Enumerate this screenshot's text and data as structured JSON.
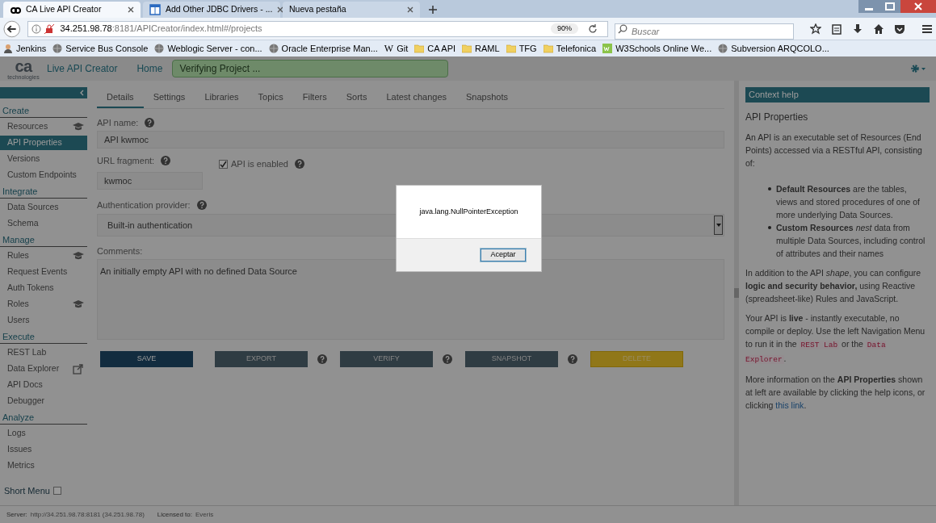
{
  "browser": {
    "tabs": [
      {
        "title": "CA Live API Creator",
        "selected": true
      },
      {
        "title": "Add Other JDBC Drivers - ...",
        "selected": false
      },
      {
        "title": "Nueva pestaña",
        "selected": false
      }
    ],
    "address": {
      "host": "34.251.98.78",
      "path": ":8181/APICreator/index.html#/projects"
    },
    "zoom": "90%",
    "search": {
      "placeholder": "Buscar"
    },
    "bookmarks": [
      {
        "label": "Jenkins"
      },
      {
        "label": "Service Bus Console"
      },
      {
        "label": "Weblogic Server - con..."
      },
      {
        "label": "Oracle Enterprise Man..."
      },
      {
        "label": "Git",
        "badge": "W"
      },
      {
        "label": "CA API"
      },
      {
        "label": "RAML"
      },
      {
        "label": "TFG"
      },
      {
        "label": "Telefonica"
      },
      {
        "label": "W3Schools Online We..."
      },
      {
        "label": "Subversion ARQCOLO..."
      }
    ]
  },
  "app": {
    "logo": {
      "mark": "ca",
      "sub": "technologies"
    },
    "product": "Live API Creator",
    "home": "Home",
    "status": "Verifying Project ..."
  },
  "sidebar": {
    "sections": [
      {
        "title": "Create",
        "items": [
          {
            "label": "Resources",
            "selected": false
          },
          {
            "label": "API Properties",
            "selected": true
          },
          {
            "label": "Versions",
            "selected": false
          },
          {
            "label": "Custom Endpoints",
            "selected": false
          }
        ]
      },
      {
        "title": "Integrate",
        "items": [
          {
            "label": "Data Sources",
            "selected": false
          },
          {
            "label": "Schema",
            "selected": false
          }
        ]
      },
      {
        "title": "Manage",
        "items": [
          {
            "label": "Rules",
            "selected": false
          },
          {
            "label": "Request Events",
            "selected": false
          },
          {
            "label": "Auth Tokens",
            "selected": false
          },
          {
            "label": "Roles",
            "selected": false
          },
          {
            "label": "Users",
            "selected": false
          }
        ]
      },
      {
        "title": "Execute",
        "items": [
          {
            "label": "REST Lab",
            "selected": false
          },
          {
            "label": "Data Explorer",
            "selected": false
          },
          {
            "label": "API Docs",
            "selected": false
          },
          {
            "label": "Debugger",
            "selected": false
          }
        ]
      },
      {
        "title": "Analyze",
        "items": [
          {
            "label": "Logs",
            "selected": false
          },
          {
            "label": "Issues",
            "selected": false
          },
          {
            "label": "Metrics",
            "selected": false
          }
        ]
      }
    ],
    "short_menu": {
      "label": "Short Menu",
      "checked": false
    }
  },
  "tabs": [
    {
      "label": "Details",
      "selected": true
    },
    {
      "label": "Settings",
      "selected": false
    },
    {
      "label": "Libraries",
      "selected": false
    },
    {
      "label": "Topics",
      "selected": false
    },
    {
      "label": "Filters",
      "selected": false
    },
    {
      "label": "Sorts",
      "selected": false
    },
    {
      "label": "Latest changes",
      "selected": false
    },
    {
      "label": "Snapshots",
      "selected": false
    }
  ],
  "form": {
    "api_name": {
      "label": "API name:",
      "value": "API kwmoc"
    },
    "url_fragment": {
      "label": "URL fragment:",
      "value": "kwmoc"
    },
    "enabled": {
      "label": "API is enabled",
      "checked": true
    },
    "auth_provider": {
      "label": "Authentication provider:",
      "value": "Built-in authentication"
    },
    "comments": {
      "label": "Comments:",
      "value": "An initially empty API with no defined Data Source"
    }
  },
  "buttons": [
    {
      "label": "SAVE",
      "kind": "primary",
      "help": false
    },
    {
      "label": "EXPORT",
      "kind": "secondary",
      "help": true
    },
    {
      "label": "VERIFY",
      "kind": "secondary",
      "help": true
    },
    {
      "label": "SNAPSHOT",
      "kind": "secondary",
      "help": true
    },
    {
      "label": "DELETE",
      "kind": "danger",
      "help": false
    }
  ],
  "help": {
    "title": "Context help",
    "heading": "API Properties",
    "blocks": [
      {
        "kind": "para",
        "parts": [
          {
            "kind": "text",
            "text": "An API is an executable set of Resources (End Points) accessed via a RESTful API, consisting of:"
          }
        ]
      },
      {
        "kind": "bullets",
        "items": [
          "**Default Resources** are the tables, views and stored procedures of one of more underlying Data Sources.",
          "**Custom Resources** *nest* data from multiple Data Sources, including control of attributes and their names"
        ]
      },
      {
        "kind": "para",
        "parts": [
          {
            "kind": "text",
            "text": "In addition to the API *shape*, you can configure **logic and security behavior,** using Reactive (spreadsheet-like) Rules and JavaScript."
          }
        ]
      },
      {
        "kind": "para",
        "parts": [
          {
            "kind": "text",
            "text": "Your API is **live** - instantly executable, no compile or deploy. Use the left Navigation Menu to run it in the "
          },
          {
            "kind": "code",
            "text": "REST Lab"
          },
          {
            "kind": "text",
            "text": " or the "
          },
          {
            "kind": "code",
            "text": "Data Explorer"
          },
          {
            "kind": "text",
            "text": "."
          }
        ]
      },
      {
        "kind": "para",
        "parts": [
          {
            "kind": "text",
            "text": "More information on the **API Properties** shown at left are available by clicking the help icons, or clicking "
          },
          {
            "kind": "link",
            "text": "this link"
          },
          {
            "kind": "text",
            "text": "."
          }
        ]
      }
    ]
  },
  "footer": [
    {
      "label": "Server:",
      "value": "http://34.251.98.78:8181 (34.251.98.78)"
    },
    {
      "label": "Licensed to:",
      "value": "Everis"
    }
  ],
  "dialog": {
    "message": "java.lang.NullPointerException",
    "button": "Aceptar"
  }
}
